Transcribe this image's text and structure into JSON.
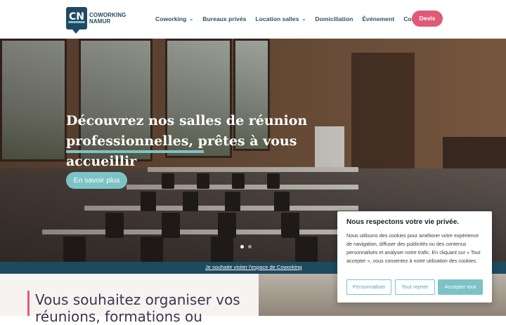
{
  "logo": {
    "badge": "CN",
    "line1": "COWORKING",
    "line2": "NAMUR"
  },
  "nav": {
    "items": [
      {
        "label": "Coworking",
        "has_dropdown": true
      },
      {
        "label": "Bureaux privés",
        "has_dropdown": false
      },
      {
        "label": "Location salles",
        "has_dropdown": true
      },
      {
        "label": "Domiciliation",
        "has_dropdown": false
      },
      {
        "label": "Événement",
        "has_dropdown": false
      },
      {
        "label": "Contact",
        "has_dropdown": false
      }
    ],
    "cta": "Devis"
  },
  "hero": {
    "title_line1": "Découvrez nos salles de réunion",
    "title_line2": "professionnelles, prêtes à vous accueillir",
    "button": "En savoir plus",
    "slides": 2,
    "active_slide": 1
  },
  "banner": {
    "link": "Je souhaite visiter l'espace de Coworking"
  },
  "section": {
    "title_line1": "Vous souhaitez organiser vos",
    "title_line2": "réunions, formations ou"
  },
  "cookie": {
    "title": "Nous respectons votre vie privée.",
    "text": "Nous utilisons des cookies pour améliorer votre expérience de navigation, diffuser des publicités ou des contenus personnalisés et analyser notre trafic. En cliquant sur « Tout accepter », vous consentez à notre utilisation des cookies.",
    "customize": "Personnaliser",
    "reject": "Tout rejeter",
    "accept": "Accepter tout"
  },
  "colors": {
    "brand_dark": "#1f4a63",
    "accent_teal": "#7cc3c5",
    "accent_pink": "#e05a77"
  },
  "icons": {
    "dropdown": "chevron-down-icon"
  }
}
